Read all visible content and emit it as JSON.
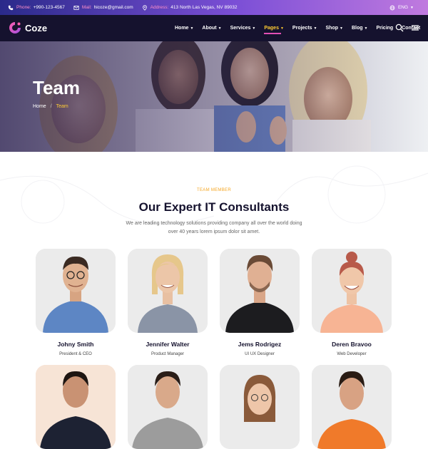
{
  "topbar": {
    "phone_label": "Phone:",
    "phone_value": "+990-123-4567",
    "mail_label": "Mail:",
    "mail_value": "hicoze@gmail.com",
    "address_label": "Address:",
    "address_value": "413 North Las Vegas, NV 89032",
    "language": "ENG"
  },
  "header": {
    "logo_text": "Coze",
    "nav": [
      {
        "label": "Home",
        "has_dropdown": true
      },
      {
        "label": "About",
        "has_dropdown": true
      },
      {
        "label": "Services",
        "has_dropdown": true
      },
      {
        "label": "Pages",
        "has_dropdown": true,
        "active": true
      },
      {
        "label": "Projects",
        "has_dropdown": true
      },
      {
        "label": "Shop",
        "has_dropdown": true
      },
      {
        "label": "Blog",
        "has_dropdown": true
      },
      {
        "label": "Pricing",
        "has_dropdown": false
      },
      {
        "label": "Contact",
        "has_dropdown": false
      }
    ],
    "icons": [
      "search-icon",
      "menu-icon"
    ]
  },
  "hero": {
    "title": "Team",
    "breadcrumb_home": "Home",
    "breadcrumb_sep": "/",
    "breadcrumb_current": "Team"
  },
  "section": {
    "tag": "TEAM MEMBER",
    "title": "Our Expert IT Consultants",
    "description": "We are leading technology solutions providing company all over the world doing over 40 years lorem ipsum dolor sit amet."
  },
  "team": [
    {
      "name": "Johny Smith",
      "role": "President & CEO"
    },
    {
      "name": "Jennifer Walter",
      "role": "Product Manager"
    },
    {
      "name": "Jems Rodrigez",
      "role": "UI UX Designer"
    },
    {
      "name": "Deren Bravoo",
      "role": "Web Developer"
    }
  ],
  "colors": {
    "accent_yellow": "#ffcc33",
    "accent_pink": "#e24fb5",
    "dark_navy": "#15122e",
    "tag_orange": "#f5a623"
  }
}
